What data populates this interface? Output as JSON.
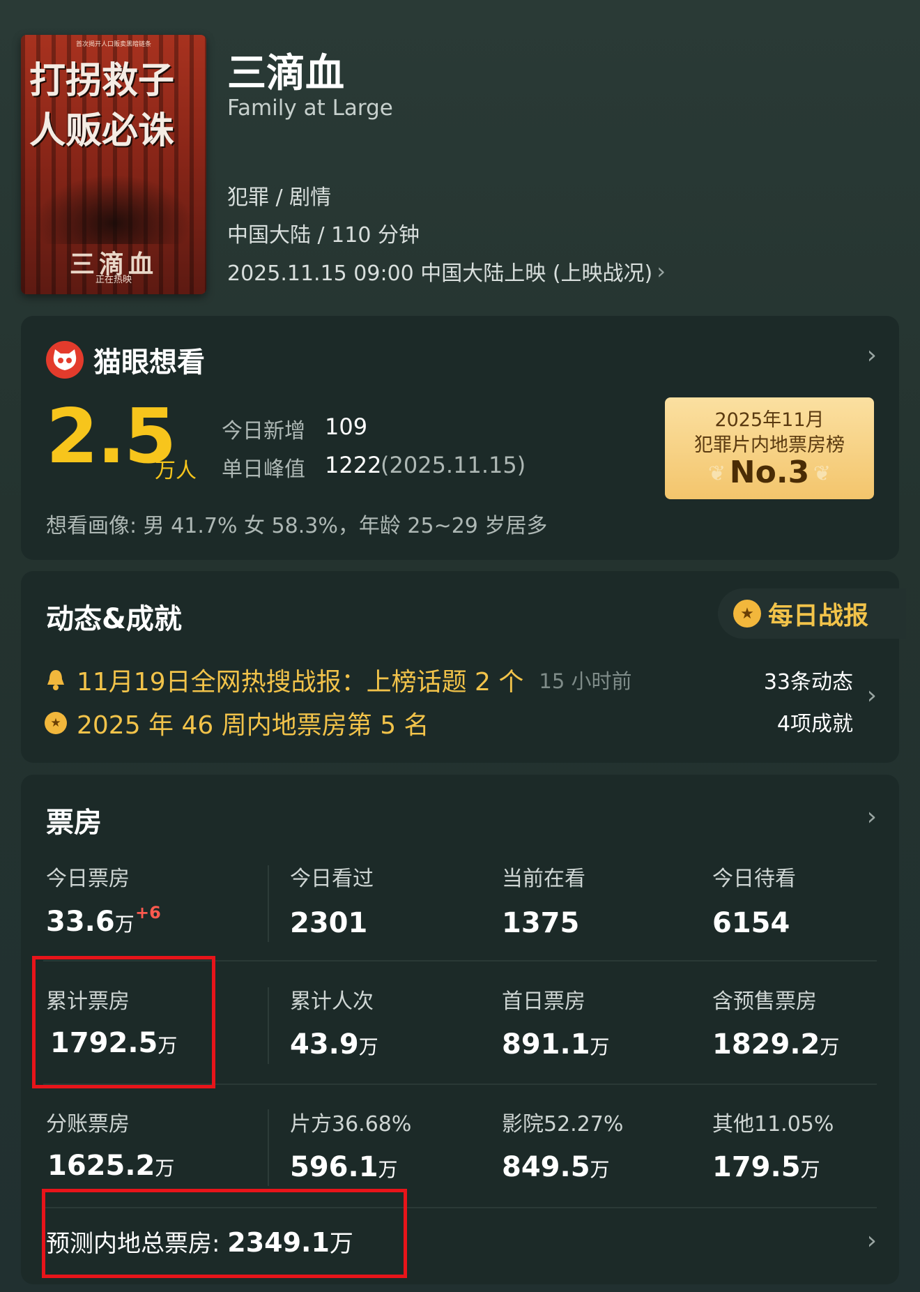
{
  "header": {
    "poster": {
      "top_line": "首次揭开人口贩卖黑暗链条",
      "slogan_line1": "打拐救子",
      "slogan_line2": "人贩必诛",
      "title_calligraphy": "三滴血",
      "status": "正在热映"
    },
    "title": "三滴血",
    "english_title": "Family at Large",
    "genre": "犯罪 / 剧情",
    "region_runtime": "中国大陆 / 110 分钟",
    "release": "2025.11.15 09:00 中国大陆上映 (上映战况)",
    "release_chevron": "›"
  },
  "want": {
    "title": "猫眼想看",
    "count": "2.5",
    "unit": "万人",
    "today_label": "今日新增",
    "today_value": "109",
    "peak_label": "单日峰值",
    "peak_value": "1222",
    "peak_date": "(2025.11.15)",
    "rank_line1": "2025年11月",
    "rank_line2": "犯罪片内地票房榜",
    "rank_value": "No.3",
    "portrait": "想看画像: 男 41.7%  女 58.3%，年龄 25~29 岁居多",
    "chevron": "›"
  },
  "dynamics": {
    "title": "动态&成就",
    "daily_report": "每日战报",
    "news1": "11月19日全网热搜战报：上榜话题 2 个",
    "news1_time": "15 小时前",
    "news2": "2025 年 46 周内地票房第 5 名",
    "dynamic_count": "33条动态",
    "achievement_count": "4项成就",
    "chevron": "›"
  },
  "boxoffice": {
    "title": "票房",
    "chevron": "›",
    "rows": [
      [
        {
          "label": "今日票房",
          "value": "33.6",
          "unit": "万",
          "delta": "+6"
        },
        {
          "label": "今日看过",
          "value": "2301",
          "unit": ""
        },
        {
          "label": "当前在看",
          "value": "1375",
          "unit": ""
        },
        {
          "label": "今日待看",
          "value": "6154",
          "unit": ""
        }
      ],
      [
        {
          "label": "累计票房",
          "value": "1792.5",
          "unit": "万"
        },
        {
          "label": "累计人次",
          "value": "43.9",
          "unit": "万"
        },
        {
          "label": "首日票房",
          "value": "891.1",
          "unit": "万"
        },
        {
          "label": "含预售票房",
          "value": "1829.2",
          "unit": "万"
        }
      ],
      [
        {
          "label": "分账票房",
          "value": "1625.2",
          "unit": "万"
        },
        {
          "label": "片方36.68%",
          "value": "596.1",
          "unit": "万"
        },
        {
          "label": "影院52.27%",
          "value": "849.5",
          "unit": "万"
        },
        {
          "label": "其他11.05%",
          "value": "179.5",
          "unit": "万"
        }
      ]
    ],
    "forecast_label": "预测内地总票房:",
    "forecast_value": "2349.1",
    "forecast_unit": "万"
  },
  "colors": {
    "accent_gold": "#f7c51c",
    "highlight_red": "#e8141a",
    "card_bg": "#1c2a28"
  }
}
